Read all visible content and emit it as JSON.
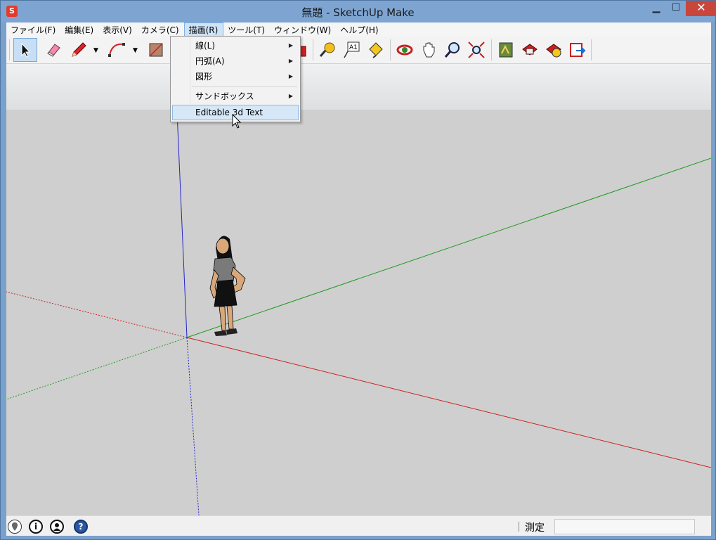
{
  "window": {
    "title": "無題 - SketchUp Make",
    "app_icon": "sketchup-logo-icon",
    "minimize_glyph": "▁",
    "maximize_glyph": "☐",
    "close_glyph": "✕"
  },
  "menubar": {
    "items": [
      {
        "label": "ファイル(F)"
      },
      {
        "label": "編集(E)"
      },
      {
        "label": "表示(V)"
      },
      {
        "label": "カメラ(C)"
      },
      {
        "label": "描画(R)"
      },
      {
        "label": "ツール(T)"
      },
      {
        "label": "ウィンドウ(W)"
      },
      {
        "label": "ヘルプ(H)"
      }
    ],
    "active": "描画(R)"
  },
  "toolbar": {
    "tools": [
      "select-icon",
      "eraser-icon",
      "line-pencil-icon",
      "arc-icon",
      "rectangle-icon",
      "push-pull-icon",
      "tape-measure-icon",
      "text-icon",
      "paint-bucket-icon",
      "orbit-icon",
      "pan-icon",
      "zoom-icon",
      "zoom-extents-icon",
      "3d-warehouse-icon",
      "extension-warehouse-icon",
      "share-component-icon",
      "layout-send-icon"
    ]
  },
  "draw_menu": {
    "items": [
      {
        "label": "線(L)",
        "submenu": true
      },
      {
        "label": "円弧(A)",
        "submenu": true
      },
      {
        "label": "図形",
        "submenu": true
      },
      {
        "label": "サンドボックス",
        "submenu": true
      },
      {
        "label": "Editable 3d Text",
        "submenu": false
      }
    ],
    "highlighted": "Editable 3d Text",
    "arrow_glyph": "▶"
  },
  "statusbar": {
    "icons": [
      "geo-location-icon",
      "credits-icon",
      "user-account-icon",
      "help-icon"
    ],
    "measurements_label": "測定",
    "measurements_value": ""
  },
  "colors": {
    "red_axis": "#cc2020",
    "green_axis": "#1e9a1e",
    "blue_axis": "#2424c8",
    "ground": "#cfcfcf",
    "menu_highlight": "#d6e7f8"
  }
}
